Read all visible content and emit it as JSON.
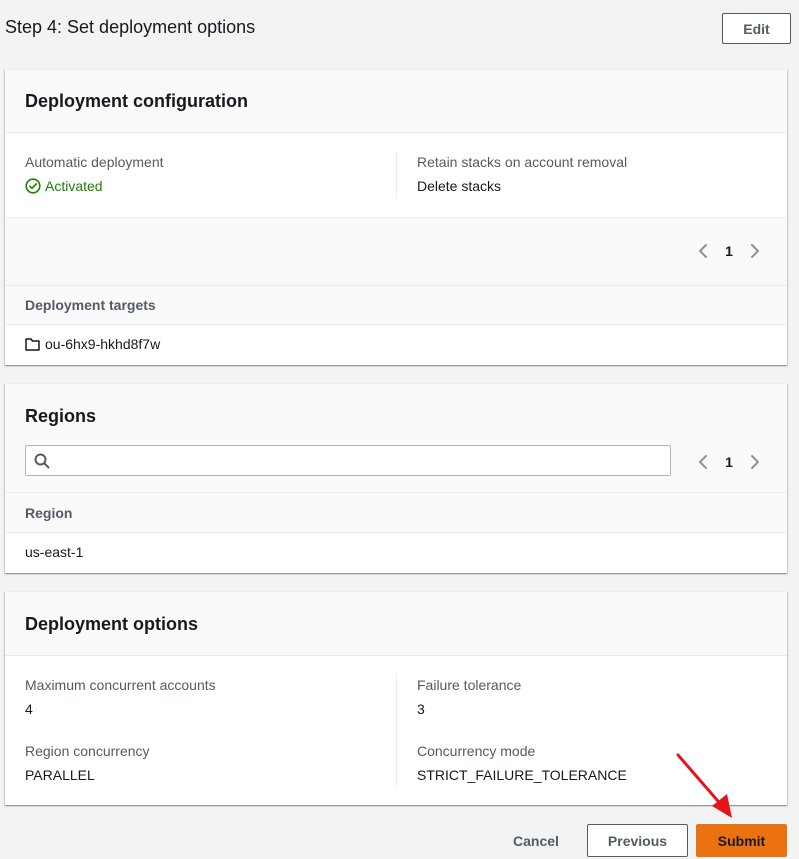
{
  "step": {
    "title": "Step 4: Set deployment options",
    "edit_label": "Edit"
  },
  "deployment_configuration": {
    "title": "Deployment configuration",
    "automatic_deployment": {
      "label": "Automatic deployment",
      "value": "Activated"
    },
    "retain_stacks": {
      "label": "Retain stacks on account removal",
      "value": "Delete stacks"
    },
    "pagination": {
      "page": "1"
    },
    "targets": {
      "header": "Deployment targets",
      "rows": [
        "ou-6hx9-hkhd8f7w"
      ]
    }
  },
  "regions": {
    "title": "Regions",
    "search": {
      "placeholder": "",
      "value": ""
    },
    "pagination": {
      "page": "1"
    },
    "table": {
      "header": "Region",
      "rows": [
        "us-east-1"
      ]
    }
  },
  "deployment_options": {
    "title": "Deployment options",
    "max_concurrent_accounts": {
      "label": "Maximum concurrent accounts",
      "value": "4"
    },
    "failure_tolerance": {
      "label": "Failure tolerance",
      "value": "3"
    },
    "region_concurrency": {
      "label": "Region concurrency",
      "value": "PARALLEL"
    },
    "concurrency_mode": {
      "label": "Concurrency mode",
      "value": "STRICT_FAILURE_TOLERANCE"
    }
  },
  "footer": {
    "cancel_label": "Cancel",
    "previous_label": "Previous",
    "submit_label": "Submit"
  },
  "colors": {
    "success": "#1d8102",
    "primary_button": "#ec7211",
    "annotation_arrow": "#e3151b",
    "background": "#f2f3f3"
  },
  "icons": {
    "status": "check-circle-icon",
    "target": "folder-icon",
    "search": "search-icon",
    "prev_page": "chevron-left-icon",
    "next_page": "chevron-right-icon",
    "annotation": "red-arrow-icon"
  }
}
